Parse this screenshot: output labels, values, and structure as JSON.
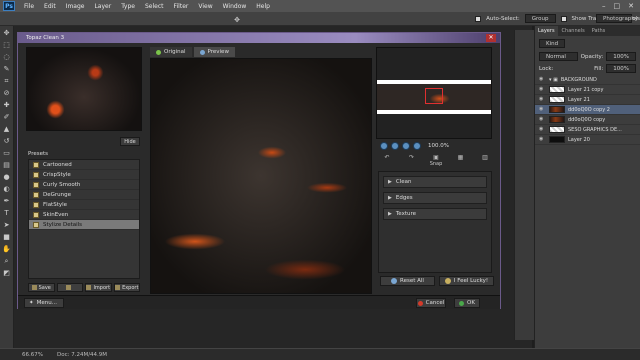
{
  "menubar": {
    "logo": "Ps",
    "items": [
      "File",
      "Edit",
      "Image",
      "Layer",
      "Type",
      "Select",
      "Filter",
      "View",
      "Window",
      "Help"
    ],
    "window_controls": [
      "–",
      "□",
      "✕"
    ]
  },
  "options": {
    "auto_select_label": "Auto-Select:",
    "auto_select_value": "Group",
    "transform_label": "Show Transform Controls",
    "workspace": "Photography"
  },
  "layers_panel": {
    "tabs": [
      "Layers",
      "Channels",
      "Paths"
    ],
    "kind": "Kind",
    "blend_mode": "Normal",
    "opacity_label": "Opacity:",
    "opacity_value": "100%",
    "lock_label": "Lock:",
    "fill_label": "Fill:",
    "fill_value": "100%",
    "rows": [
      {
        "name": "BACKGROUND",
        "thumb": "none",
        "selected": false
      },
      {
        "name": "Layer 21 copy",
        "thumb": "white",
        "selected": false
      },
      {
        "name": "Layer 21",
        "thumb": "white",
        "selected": false
      },
      {
        "name": "dd0oQ0O copy 2",
        "thumb": "lava",
        "selected": true
      },
      {
        "name": "dd0oQ0O copy",
        "thumb": "lava",
        "selected": false
      },
      {
        "name": "SESO GRAPHICS DE...",
        "thumb": "white",
        "selected": false
      },
      {
        "name": "Layer 20",
        "thumb": "black",
        "selected": false
      }
    ]
  },
  "statusbar": {
    "zoom": "66.67%",
    "doc": "Doc: 7.24M/44.9M"
  },
  "topaz": {
    "title": "Topaz Clean 3",
    "close": "✕",
    "hide_button": "Hide",
    "presets_label": "Presets",
    "presets": [
      {
        "label": "Cartooned",
        "selected": false
      },
      {
        "label": "CrispStyle",
        "selected": false
      },
      {
        "label": "Curly Smooth",
        "selected": false
      },
      {
        "label": "DeGrunge",
        "selected": false
      },
      {
        "label": "FlatStyle",
        "selected": false
      },
      {
        "label": "SkinEven",
        "selected": false
      },
      {
        "label": "Stylize Details",
        "selected": true
      }
    ],
    "preset_buttons": [
      "Save",
      "",
      "Import",
      "Export"
    ],
    "view_tabs": [
      "Original",
      "Preview"
    ],
    "zoom": "100.0%",
    "snap_label": "Snap",
    "adjustments": [
      "Clean",
      "Edges",
      "Texture"
    ],
    "reset_all": "Reset All",
    "feel_lucky": "I Feel Lucky!",
    "menu_button": "Menu...",
    "cancel_button": "Cancel",
    "ok_button": "OK"
  },
  "colors": {
    "title_accent": "#8a7cb8",
    "selected_layer": "#50607a",
    "lava": "#d2501a"
  }
}
